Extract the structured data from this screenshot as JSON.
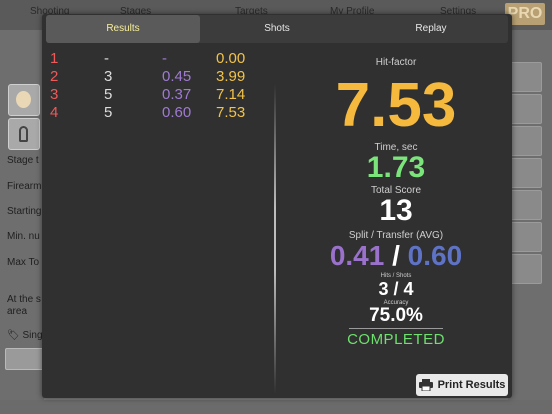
{
  "background": {
    "nav_items": [
      "Shooting",
      "Stages",
      "Targets",
      "My Profile",
      "Settings"
    ],
    "pro_badge": "PRO",
    "field_labels": [
      "Stage t",
      "Firearm",
      "Starting",
      "Min. nu",
      "Max To",
      "At the s",
      "area"
    ],
    "tag_label": "Sing"
  },
  "modal": {
    "tabs": [
      "Results",
      "Shots",
      "Replay"
    ],
    "active_tab": "Results",
    "shots": [
      {
        "num": "1",
        "zone": "-",
        "split": "-",
        "hf": "0.00"
      },
      {
        "num": "2",
        "zone": "3",
        "split": "0.45",
        "hf": "3.99"
      },
      {
        "num": "3",
        "zone": "5",
        "split": "0.37",
        "hf": "7.14"
      },
      {
        "num": "4",
        "zone": "5",
        "split": "0.60",
        "hf": "7.53"
      }
    ],
    "stats": {
      "hit_factor_label": "Hit-factor",
      "hit_factor": "7.53",
      "time_label": "Time, sec",
      "time": "1.73",
      "score_label": "Total Score",
      "score": "13",
      "split_label": "Split / Transfer (AVG)",
      "split_avg": "0.41",
      "split_sep": "/",
      "transfer_avg": "0.60",
      "hits_label": "Hits / Shots",
      "hits": "3 / 4",
      "accuracy_label": "Accuracy",
      "accuracy": "75.0%",
      "status": "COMPLETED"
    },
    "print_label": "Print Results"
  },
  "colors": {
    "hit_factor": "#f5b93d",
    "time": "#7be57b",
    "split": "#9a72cc",
    "transfer": "#5f73c6",
    "shot_number": "#ee5a5a",
    "status": "#6de06d"
  }
}
